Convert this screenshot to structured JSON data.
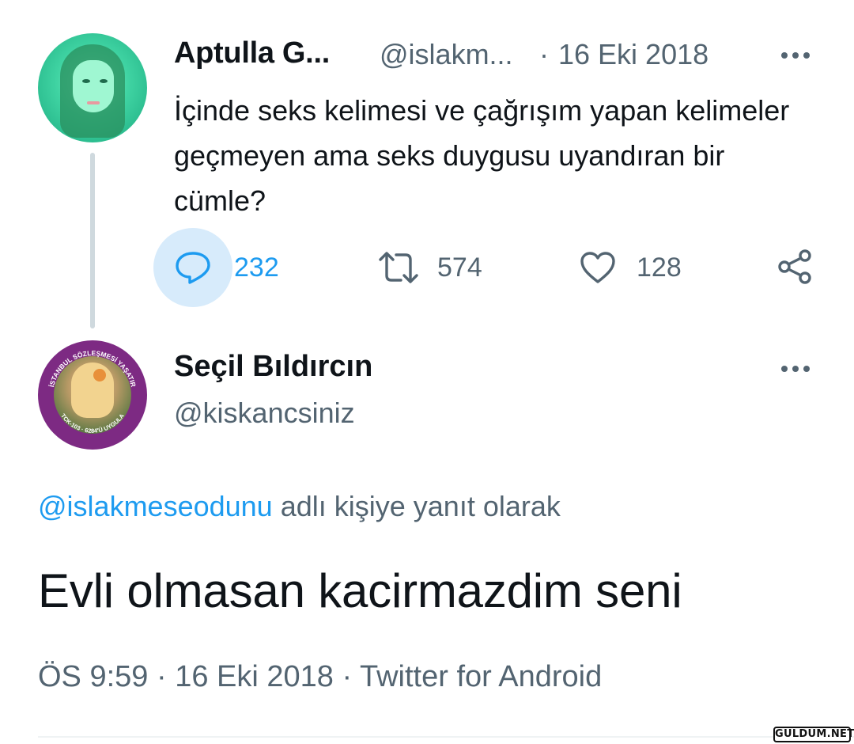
{
  "parent_tweet": {
    "display_name": "Aptulla G...",
    "handle": "@islakm...",
    "separator": "·",
    "date": "16 Eki 2018",
    "more_icon": "more-horizontal-icon",
    "text": "İçinde seks kelimesi ve çağrışım yapan kelimeler geçmeyen ama seks duygusu uyandıran bir cümle?",
    "actions": {
      "reply_count": "232",
      "retweet_count": "574",
      "like_count": "128"
    },
    "icons": [
      "reply-icon",
      "retweet-icon",
      "like-icon",
      "share-icon"
    ],
    "reply_accent": "#1d9bf0"
  },
  "reply_tweet": {
    "display_name": "Seçil Bıldırcın",
    "handle": "@kiskancsiniz",
    "more_icon": "more-horizontal-icon",
    "replying_to_mention": "@islakmeseodunu",
    "replying_to_suffix": "adlı kişiye yanıt olarak",
    "text": "Evli olmasan kacirmazdim seni",
    "meta": "ÖS 9:59 · 16 Eki 2018 · Twitter for Android",
    "avatar_ring_text": "İSTANBUL SÖZLEŞMESİ YAŞATIR · TCK-103 · 6284'Ü UYGULA"
  },
  "watermark": "GULDUM.NET",
  "colors": {
    "text_primary": "#0f1419",
    "text_secondary": "#536471",
    "link": "#1d9bf0",
    "thread_line": "#cfd9de"
  }
}
